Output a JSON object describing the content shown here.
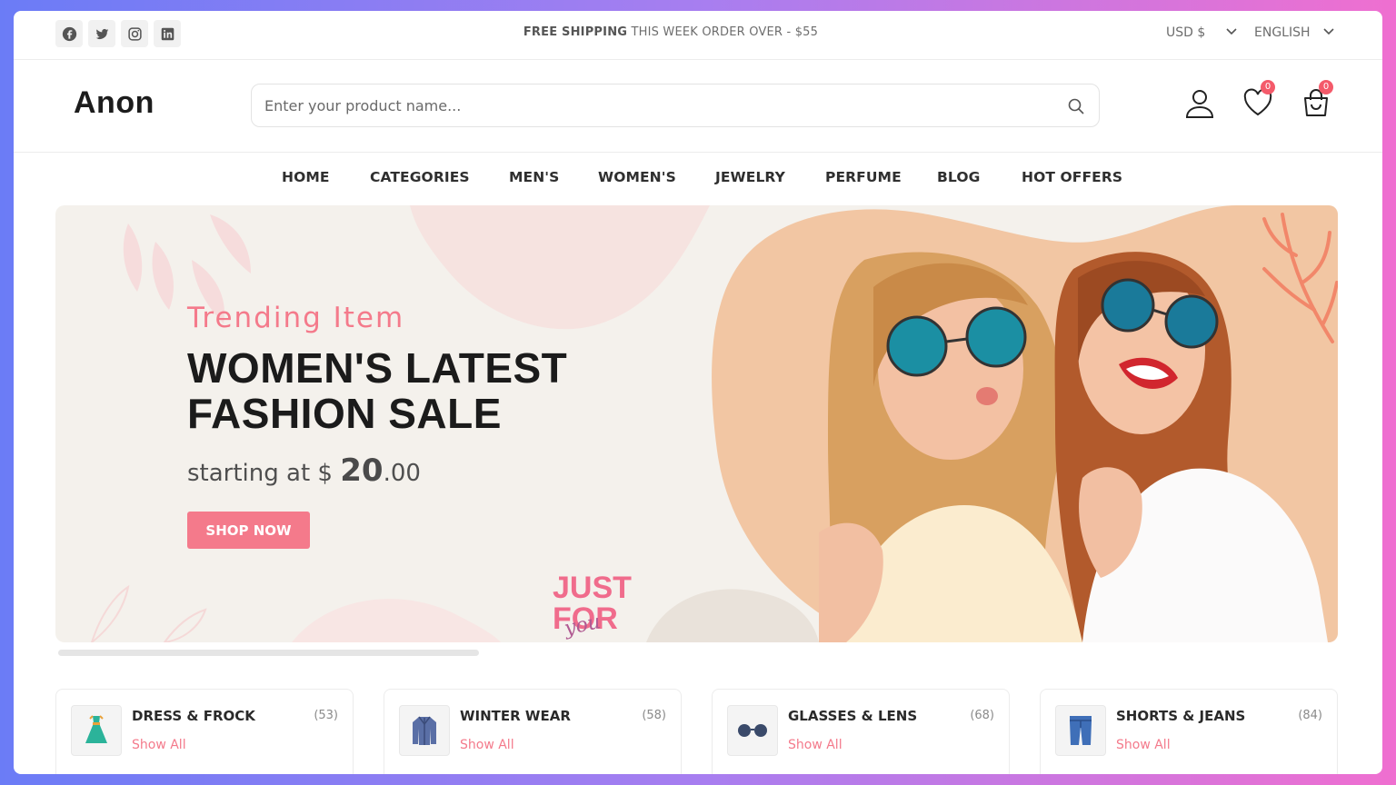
{
  "topbar": {
    "socials": [
      "facebook-icon",
      "twitter-icon",
      "instagram-icon",
      "linkedin-icon"
    ],
    "promo_bold": "FREE SHIPPING",
    "promo_rest": " THIS WEEK ORDER OVER - $55",
    "currency": "USD $",
    "language": "ENGLISH"
  },
  "header": {
    "logo": "Anon",
    "search_placeholder": "Enter your product name...",
    "wishlist_count": "0",
    "cart_count": "0"
  },
  "nav": {
    "items": [
      "HOME",
      "CATEGORIES",
      "MEN'S",
      "WOMEN'S",
      "JEWELRY",
      "PERFUME",
      "BLOG",
      "HOT OFFERS"
    ]
  },
  "banner": {
    "subtitle": "Trending Item",
    "title_line1": "WOMEN'S LATEST",
    "title_line2": "FASHION SALE",
    "price_prefix": "starting at $ ",
    "price_main": "20",
    "price_cents": ".00",
    "button": "SHOP NOW",
    "sticker_just": "JUST",
    "sticker_for": "FOR",
    "sticker_you": "you"
  },
  "categories": [
    {
      "title": "DRESS & FROCK",
      "count": "(53)",
      "link": "Show All",
      "icon": "dress-icon"
    },
    {
      "title": "WINTER WEAR",
      "count": "(58)",
      "link": "Show All",
      "icon": "coat-icon"
    },
    {
      "title": "GLASSES & LENS",
      "count": "(68)",
      "link": "Show All",
      "icon": "glasses-icon"
    },
    {
      "title": "SHORTS & JEANS",
      "count": "(84)",
      "link": "Show All",
      "icon": "jeans-icon"
    }
  ],
  "colors": {
    "accent": "#f47a8b",
    "text_dark": "#1b1b1b",
    "banner_bg": "#f4f1ec"
  }
}
